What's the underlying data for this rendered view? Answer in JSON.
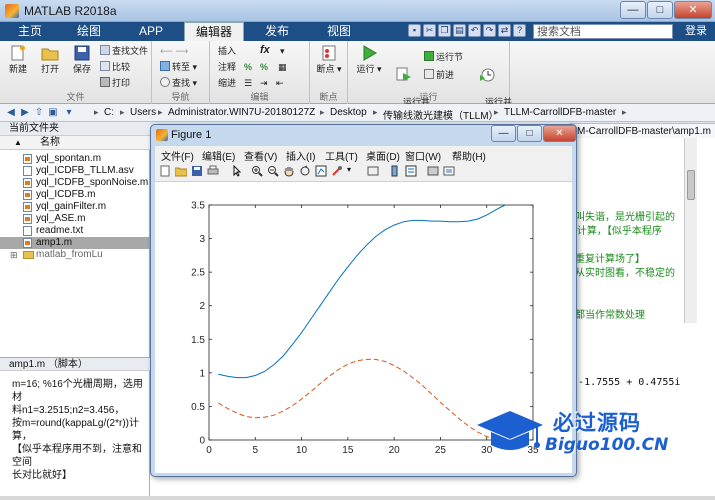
{
  "window": {
    "title": "MATLAB R2018a",
    "min_glyph": "—",
    "max_glyph": "□",
    "close_glyph": "✕"
  },
  "tabs": [
    "主页",
    "绘图",
    "APP",
    "编辑器",
    "发布",
    "视图"
  ],
  "search": {
    "placeholder": "搜索文档"
  },
  "login": "登录",
  "ribbon": {
    "file": {
      "label": "文件",
      "new": "新建",
      "open": "打开",
      "save": "保存",
      "find_files": "查找文件",
      "compare": "比较",
      "print": "打印"
    },
    "navigate": {
      "label": "导航",
      "goto": "转至",
      "find": "查找"
    },
    "edit": {
      "label": "编辑",
      "insert": "插入",
      "comment": "注释",
      "indent": "缩进",
      "fx": "fx"
    },
    "breakpoints": {
      "label": "断点",
      "breakpoints": "断点"
    },
    "run": {
      "label": "运行",
      "run": "运行",
      "run_advance": "运行并\n前进",
      "run_section": "运行节",
      "advance": "前进",
      "run_time": "运行并\n计时"
    }
  },
  "address": {
    "crumbs": [
      "C:",
      "Users",
      "Administrator.WIN7U-20180127Z",
      "Desktop",
      "传输线激光建模（TLLM）",
      "TLLM-CarrollDFB-master"
    ]
  },
  "files": {
    "header": "当前文件夹",
    "column": "名称",
    "sort_glyph": "▲",
    "items": [
      {
        "name": "yql_spontan.m",
        "type": "m",
        "selected": false
      },
      {
        "name": "yql_ICDFB_TLLM.asv",
        "type": "file",
        "selected": false
      },
      {
        "name": "yql_ICDFB_sponNoise.m",
        "type": "m",
        "selected": false
      },
      {
        "name": "yql_ICDFB.m",
        "type": "m",
        "selected": false
      },
      {
        "name": "yql_gainFilter.m",
        "type": "m",
        "selected": false
      },
      {
        "name": "yql_ASE.m",
        "type": "m",
        "selected": false
      },
      {
        "name": "readme.txt",
        "type": "file",
        "selected": false
      },
      {
        "name": "amp1.m",
        "type": "m",
        "selected": true
      },
      {
        "name": "matlab_fromLu",
        "type": "folder",
        "selected": false
      }
    ]
  },
  "details": {
    "header": "amp1.m （脚本）",
    "lines": [
      "m=16; %16个光栅周期，选用材",
      "料n1=3.2515;n2=3.456，",
      "按m=round(kappaLg/(2*r))计算，",
      "【似乎本程序用不到，注意和空间",
      "长对比就好】"
    ]
  },
  "editor": {
    "tab": "M-CarrollDFB-master\\amp1.m",
    "code_lines": [
      {
        "text": "解叫失谐，是光栅引起的",
        "green": true
      },
      {
        "text": "r))计算，【似乎本程序",
        "green": true
      },
      {
        "text": "需重复计算场了】",
        "green": true
      },
      {
        "text": "，从实时图看，不稳定的",
        "green": true
      },
      {
        "text": "理都当作常数处理",
        "green": true
      }
    ],
    "cmd": "0i   -1.7555 + 0.4755i"
  },
  "figure": {
    "title": "Figure 1",
    "min_glyph": "—",
    "max_glyph": "□",
    "close_glyph": "✕",
    "menus": [
      "文件(F)",
      "编辑(E)",
      "查看(V)",
      "插入(I)",
      "工具(T)",
      "桌面(D)",
      "窗口(W)",
      "帮助(H)"
    ]
  },
  "chart_data": {
    "type": "line",
    "title": "",
    "xlabel": "",
    "ylabel": "",
    "xlim": [
      0,
      35
    ],
    "ylim": [
      0,
      3.5
    ],
    "xticks": [
      0,
      5,
      10,
      15,
      20,
      25,
      30,
      35
    ],
    "yticks": [
      0,
      0.5,
      1,
      1.5,
      2,
      2.5,
      3,
      3.5
    ],
    "grid": false,
    "series": [
      {
        "style": "solid",
        "color": "#0072BD",
        "x": [
          1,
          2,
          3,
          4,
          5,
          6,
          7,
          8,
          9,
          10,
          11,
          12,
          13,
          14,
          15,
          16,
          17,
          18,
          19,
          20,
          21,
          22,
          23,
          24,
          25,
          26,
          27,
          28,
          29,
          30,
          31,
          32
        ],
        "y": [
          0.98,
          0.95,
          0.93,
          0.93,
          0.96,
          1.02,
          1.12,
          1.25,
          1.42,
          1.6,
          1.8,
          2.0,
          2.2,
          2.4,
          2.58,
          2.75,
          2.9,
          3.03,
          3.13,
          3.2,
          3.25,
          3.27,
          3.27,
          3.26,
          3.26,
          3.25,
          3.25,
          3.26,
          3.29,
          3.35,
          3.43,
          3.5
        ]
      },
      {
        "style": "dashed",
        "color": "#D95319",
        "x": [
          1,
          2,
          3,
          4,
          5,
          6,
          7,
          8,
          9,
          10,
          11,
          12,
          13,
          14,
          15,
          16,
          17,
          18,
          19,
          20,
          21,
          22,
          23,
          24,
          25,
          26,
          27,
          28,
          29,
          30,
          31,
          32
        ],
        "y": [
          0.55,
          0.47,
          0.4,
          0.35,
          0.33,
          0.34,
          0.37,
          0.43,
          0.51,
          0.61,
          0.72,
          0.84,
          0.95,
          1.05,
          1.13,
          1.18,
          1.2,
          1.2,
          1.17,
          1.11,
          1.03,
          0.93,
          0.82,
          0.69,
          0.56,
          0.44,
          0.32,
          0.21,
          0.12,
          0.05,
          0.01,
          0.0
        ]
      }
    ]
  },
  "watermark": {
    "main": "必过源码",
    "site": "Biguo100.CN"
  }
}
